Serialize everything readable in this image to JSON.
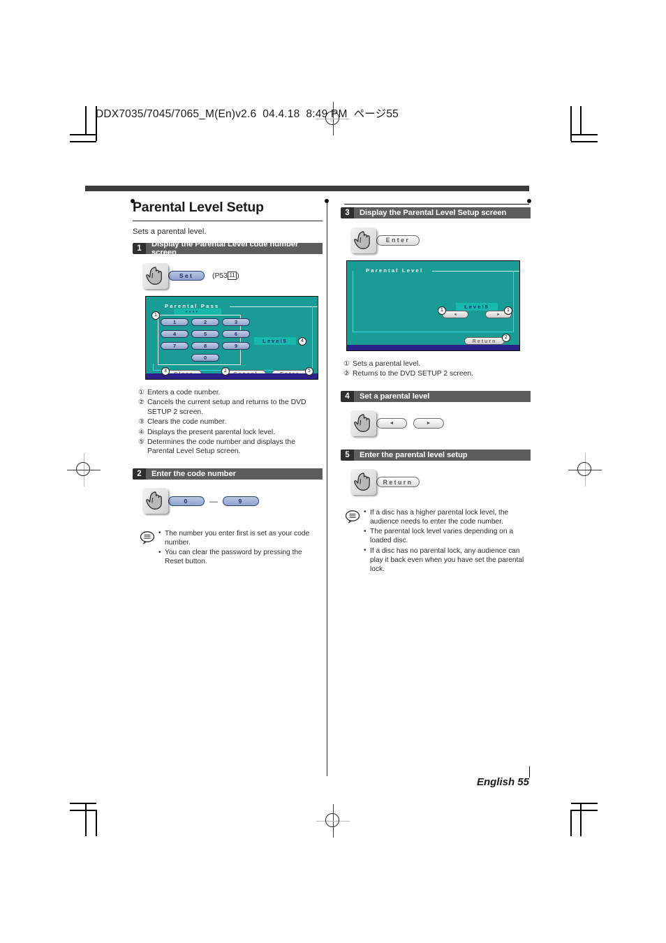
{
  "header": {
    "print_slug": "DDX7035/7045/7065_M(En)v2.6  04.4.18  8:49 PM  ページ55"
  },
  "page": {
    "title": "Parental Level Setup",
    "lede": "Sets a parental level.",
    "footer": "English 55"
  },
  "left_column": {
    "step1": {
      "num": "1",
      "title": "Display the Parental Level code number screen",
      "button": "Set",
      "ref_prefix": "(P53",
      "ref_box": "11",
      "ref_suffix": ")"
    },
    "screen1": {
      "title": "Parental  Pass",
      "keys": [
        "1",
        "2",
        "3",
        "4",
        "5",
        "6",
        "7",
        "8",
        "9",
        "0"
      ],
      "level_label": "Level5",
      "buttons": {
        "clear": "Clear",
        "cancel": "Cancel",
        "enter": "Enter"
      },
      "markers": {
        "keypad": "1",
        "cancel": "2",
        "clear": "3",
        "level": "4",
        "enter": "5"
      }
    },
    "descriptions": [
      {
        "mark": "①",
        "text": "Enters a code number."
      },
      {
        "mark": "②",
        "text": "Cancels the current setup and returns to the DVD SETUP 2 screen."
      },
      {
        "mark": "③",
        "text": "Clears the code number."
      },
      {
        "mark": "④",
        "text": "Displays the present parental lock level."
      },
      {
        "mark": "⑤",
        "text": "Determines the code number and displays the Parental Level Setup screen."
      }
    ],
    "step2": {
      "num": "2",
      "title": "Enter the code number",
      "key_from": "0",
      "key_to": "9",
      "dash": "—"
    },
    "note": [
      "The number you enter first is set as your code number.",
      "You can clear the password by pressing the Reset button."
    ]
  },
  "right_column": {
    "step3": {
      "num": "3",
      "title": "Display the Parental Level Setup screen",
      "button": "Enter"
    },
    "screen2": {
      "title": "Parental  Level",
      "level_label": "Level5",
      "arrow_left": "◄",
      "arrow_right": "►",
      "return_button": "Return",
      "markers": {
        "left_arrow": "1",
        "right_arrow": "1",
        "return": "2"
      }
    },
    "descriptions": [
      {
        "mark": "①",
        "text": "Sets a parental level."
      },
      {
        "mark": "②",
        "text": "Returns to the DVD SETUP 2 screen."
      }
    ],
    "step4": {
      "num": "4",
      "title": "Set a parental level",
      "arrow_left": "◄",
      "arrow_right": "►"
    },
    "step5": {
      "num": "5",
      "title": "Enter the parental level setup",
      "button": "Return"
    },
    "note": [
      "If a disc has a higher parental lock level, the audience needs to enter the code number.",
      "The parental lock level varies depending on a loaded disc.",
      "If a disc has no parental lock, any audience can play it back even when you have set the parental lock."
    ]
  }
}
